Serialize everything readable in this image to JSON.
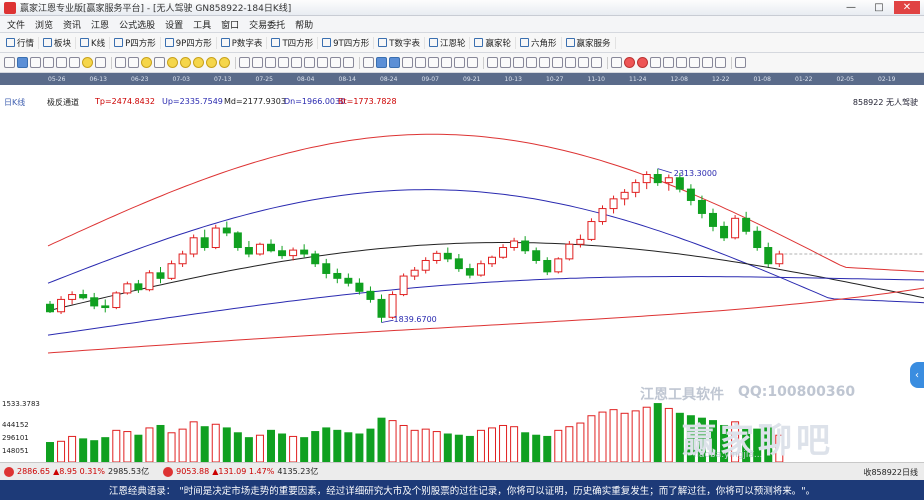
{
  "window": {
    "title": "赢家江恩专业版[赢家服务平台] - [无人驾驶 GN858922-184日K线]",
    "min": "—",
    "max": "□",
    "close": "✕"
  },
  "menu": [
    "文件",
    "浏览",
    "资讯",
    "江恩",
    "公式选股",
    "设置",
    "工具",
    "窗口",
    "交易委托",
    "帮助"
  ],
  "toolbar1": [
    "行情",
    "板块",
    "K线",
    "P四方形",
    "9P四方形",
    "P数字表",
    "T四方形",
    "9T四方形",
    "T数字表",
    "江恩轮",
    "赢家轮",
    "六角形",
    "赢家服务"
  ],
  "date_ticks": [
    "05-26",
    "06-13",
    "06-23",
    "07-03",
    "07-13",
    "07-25",
    "08-04",
    "08-14",
    "08-24",
    "09-07",
    "09-21",
    "10-13",
    "10-27",
    "11-10",
    "11-24",
    "12-08",
    "12-22",
    "01-08",
    "01-22",
    "02-05",
    "02-19"
  ],
  "chart_header": {
    "period": "日K线",
    "indicator": "极反通道",
    "tp": "Tp=2474.8432",
    "up": "Up=2335.7549",
    "md": "Md=2177.9303",
    "dn": "Dn=1966.0030",
    "bt": "Bt=1773.7828",
    "code": "858922 无人驾驶"
  },
  "chart_data": {
    "type": "candlestick",
    "annotations": [
      {
        "label": "2313.3000",
        "type": "high"
      },
      {
        "label": "1839.6700",
        "type": "low"
      }
    ],
    "candles": [
      {
        "o": 1895,
        "h": 1905,
        "l": 1868,
        "c": 1872
      },
      {
        "o": 1872,
        "h": 1920,
        "l": 1865,
        "c": 1910
      },
      {
        "o": 1910,
        "h": 1935,
        "l": 1895,
        "c": 1925
      },
      {
        "o": 1925,
        "h": 1940,
        "l": 1910,
        "c": 1915
      },
      {
        "o": 1915,
        "h": 1930,
        "l": 1880,
        "c": 1890
      },
      {
        "o": 1890,
        "h": 1910,
        "l": 1870,
        "c": 1885
      },
      {
        "o": 1885,
        "h": 1935,
        "l": 1880,
        "c": 1930
      },
      {
        "o": 1930,
        "h": 1965,
        "l": 1925,
        "c": 1958
      },
      {
        "o": 1958,
        "h": 1970,
        "l": 1930,
        "c": 1940
      },
      {
        "o": 1940,
        "h": 2000,
        "l": 1935,
        "c": 1992
      },
      {
        "o": 1992,
        "h": 2010,
        "l": 1960,
        "c": 1975
      },
      {
        "o": 1975,
        "h": 2030,
        "l": 1970,
        "c": 2020
      },
      {
        "o": 2020,
        "h": 2060,
        "l": 2010,
        "c": 2050
      },
      {
        "o": 2050,
        "h": 2110,
        "l": 2040,
        "c": 2100
      },
      {
        "o": 2100,
        "h": 2125,
        "l": 2060,
        "c": 2070
      },
      {
        "o": 2070,
        "h": 2140,
        "l": 2065,
        "c": 2130
      },
      {
        "o": 2130,
        "h": 2150,
        "l": 2105,
        "c": 2115
      },
      {
        "o": 2115,
        "h": 2120,
        "l": 2060,
        "c": 2070
      },
      {
        "o": 2070,
        "h": 2090,
        "l": 2040,
        "c": 2050
      },
      {
        "o": 2050,
        "h": 2085,
        "l": 2045,
        "c": 2080
      },
      {
        "o": 2080,
        "h": 2095,
        "l": 2055,
        "c": 2060
      },
      {
        "o": 2060,
        "h": 2075,
        "l": 2035,
        "c": 2045
      },
      {
        "o": 2045,
        "h": 2070,
        "l": 2030,
        "c": 2062
      },
      {
        "o": 2062,
        "h": 2080,
        "l": 2040,
        "c": 2050
      },
      {
        "o": 2050,
        "h": 2060,
        "l": 2010,
        "c": 2020
      },
      {
        "o": 2020,
        "h": 2035,
        "l": 1975,
        "c": 1990
      },
      {
        "o": 1990,
        "h": 2005,
        "l": 1960,
        "c": 1975
      },
      {
        "o": 1975,
        "h": 1990,
        "l": 1950,
        "c": 1960
      },
      {
        "o": 1960,
        "h": 1975,
        "l": 1925,
        "c": 1935
      },
      {
        "o": 1935,
        "h": 1950,
        "l": 1900,
        "c": 1910
      },
      {
        "o": 1910,
        "h": 1925,
        "l": 1839,
        "c": 1855
      },
      {
        "o": 1855,
        "h": 1935,
        "l": 1850,
        "c": 1925
      },
      {
        "o": 1925,
        "h": 1990,
        "l": 1920,
        "c": 1982
      },
      {
        "o": 1982,
        "h": 2010,
        "l": 1970,
        "c": 2000
      },
      {
        "o": 2000,
        "h": 2040,
        "l": 1990,
        "c": 2030
      },
      {
        "o": 2030,
        "h": 2060,
        "l": 2020,
        "c": 2052
      },
      {
        "o": 2052,
        "h": 2070,
        "l": 2025,
        "c": 2035
      },
      {
        "o": 2035,
        "h": 2050,
        "l": 1995,
        "c": 2005
      },
      {
        "o": 2005,
        "h": 2020,
        "l": 1975,
        "c": 1985
      },
      {
        "o": 1985,
        "h": 2030,
        "l": 1980,
        "c": 2020
      },
      {
        "o": 2020,
        "h": 2045,
        "l": 2010,
        "c": 2040
      },
      {
        "o": 2040,
        "h": 2080,
        "l": 2035,
        "c": 2070
      },
      {
        "o": 2070,
        "h": 2100,
        "l": 2060,
        "c": 2090
      },
      {
        "o": 2090,
        "h": 2105,
        "l": 2050,
        "c": 2060
      },
      {
        "o": 2060,
        "h": 2070,
        "l": 2020,
        "c": 2030
      },
      {
        "o": 2030,
        "h": 2040,
        "l": 1985,
        "c": 1995
      },
      {
        "o": 1995,
        "h": 2040,
        "l": 1990,
        "c": 2035
      },
      {
        "o": 2035,
        "h": 2090,
        "l": 2030,
        "c": 2080
      },
      {
        "o": 2080,
        "h": 2110,
        "l": 2070,
        "c": 2095
      },
      {
        "o": 2095,
        "h": 2160,
        "l": 2090,
        "c": 2150
      },
      {
        "o": 2150,
        "h": 2200,
        "l": 2140,
        "c": 2190
      },
      {
        "o": 2190,
        "h": 2230,
        "l": 2175,
        "c": 2220
      },
      {
        "o": 2220,
        "h": 2250,
        "l": 2200,
        "c": 2240
      },
      {
        "o": 2240,
        "h": 2280,
        "l": 2225,
        "c": 2270
      },
      {
        "o": 2270,
        "h": 2305,
        "l": 2250,
        "c": 2295
      },
      {
        "o": 2295,
        "h": 2313,
        "l": 2260,
        "c": 2270
      },
      {
        "o": 2270,
        "h": 2295,
        "l": 2245,
        "c": 2285
      },
      {
        "o": 2285,
        "h": 2300,
        "l": 2240,
        "c": 2250
      },
      {
        "o": 2250,
        "h": 2265,
        "l": 2200,
        "c": 2215
      },
      {
        "o": 2215,
        "h": 2230,
        "l": 2160,
        "c": 2175
      },
      {
        "o": 2175,
        "h": 2190,
        "l": 2120,
        "c": 2135
      },
      {
        "o": 2135,
        "h": 2150,
        "l": 2090,
        "c": 2100
      },
      {
        "o": 2100,
        "h": 2170,
        "l": 2095,
        "c": 2160
      },
      {
        "o": 2160,
        "h": 2180,
        "l": 2110,
        "c": 2120
      },
      {
        "o": 2120,
        "h": 2135,
        "l": 2060,
        "c": 2070
      },
      {
        "o": 2070,
        "h": 2085,
        "l": 2010,
        "c": 2020
      },
      {
        "o": 2020,
        "h": 2060,
        "l": 2010,
        "c": 2050
      }
    ],
    "volumes_k": [
      160,
      170,
      210,
      190,
      175,
      200,
      260,
      250,
      220,
      280,
      300,
      240,
      270,
      330,
      290,
      310,
      280,
      240,
      200,
      220,
      260,
      230,
      210,
      200,
      250,
      280,
      260,
      240,
      230,
      270,
      360,
      340,
      300,
      260,
      270,
      250,
      230,
      220,
      210,
      260,
      280,
      300,
      290,
      240,
      220,
      210,
      260,
      290,
      320,
      380,
      410,
      430,
      400,
      420,
      450,
      480,
      440,
      400,
      380,
      360,
      340,
      300,
      330,
      290,
      270,
      280,
      220
    ],
    "vol_labels": [
      "1533.3783",
      "444152",
      "296101",
      "148051"
    ]
  },
  "watermark": {
    "brand": "江恩工具软件",
    "qq": "QQ:100800360",
    "forum": "赢家聊吧",
    "url": "liaoba.yingjia..."
  },
  "statusbar": {
    "sh_idx": "2886.65",
    "sh_chg": "▲8.95 0.31%",
    "sh_amt": "2985.53亿",
    "sz_idx": "9053.88",
    "sz_chg": "▲131.09 1.47%",
    "sz_amt": "4135.23亿",
    "right": "收858922日线"
  },
  "quote": {
    "label": "江恩经典语录：",
    "text": "\"时间是决定市场走势的重要因素，经过详细研究大市及个别股票的过往记录，你将可以证明，历史确实重复发生；而了解过往，你将可以预测将来。\"。"
  },
  "colors": {
    "up": "#e02020",
    "down": "#10a020",
    "band_red": "#d33",
    "band_blue": "#2a2ab0",
    "mid": "#222"
  }
}
